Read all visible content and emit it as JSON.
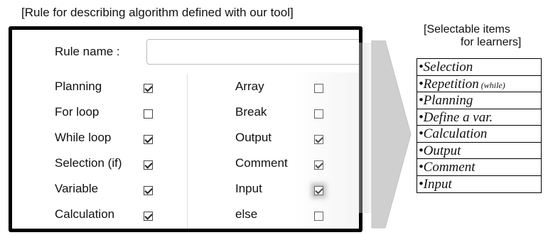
{
  "caption_left": "[Rule for describing algorithm defined with our tool]",
  "form": {
    "rule_name_label": "Rule name :",
    "rule_name_value": "",
    "left_options": [
      {
        "label": "Planning",
        "checked": true
      },
      {
        "label": "For loop",
        "checked": false
      },
      {
        "label": "While loop",
        "checked": true
      },
      {
        "label": "Selection (if)",
        "checked": true
      },
      {
        "label": "Variable",
        "checked": true
      },
      {
        "label": "Calculation",
        "checked": true
      }
    ],
    "right_options": [
      {
        "label": "Array",
        "checked": false
      },
      {
        "label": "Break",
        "checked": false
      },
      {
        "label": "Output",
        "checked": true
      },
      {
        "label": "Comment",
        "checked": true
      },
      {
        "label": "Input",
        "checked": true,
        "highlighted": true
      },
      {
        "label": "else",
        "checked": false
      }
    ]
  },
  "caption_right": {
    "line1": "[Selectable items",
    "line2": "for learners]"
  },
  "selectable_items": [
    {
      "bullet": "•",
      "text": "Selection",
      "note": ""
    },
    {
      "bullet": "•",
      "text": "Repetition",
      "note": " (while)"
    },
    {
      "bullet": "•",
      "text": "Planning",
      "note": ""
    },
    {
      "bullet": "•",
      "text": "Define a var.",
      "note": ""
    },
    {
      "bullet": "•",
      "text": "Calculation",
      "note": ""
    },
    {
      "bullet": "•",
      "text": "Output",
      "note": ""
    },
    {
      "bullet": "•",
      "text": "Comment",
      "note": ""
    },
    {
      "bullet": "•",
      "text": "Input",
      "note": ""
    }
  ],
  "colors": {
    "panel_border": "#000000",
    "arrow": "#cfcfcf",
    "highlight": "#888888"
  }
}
